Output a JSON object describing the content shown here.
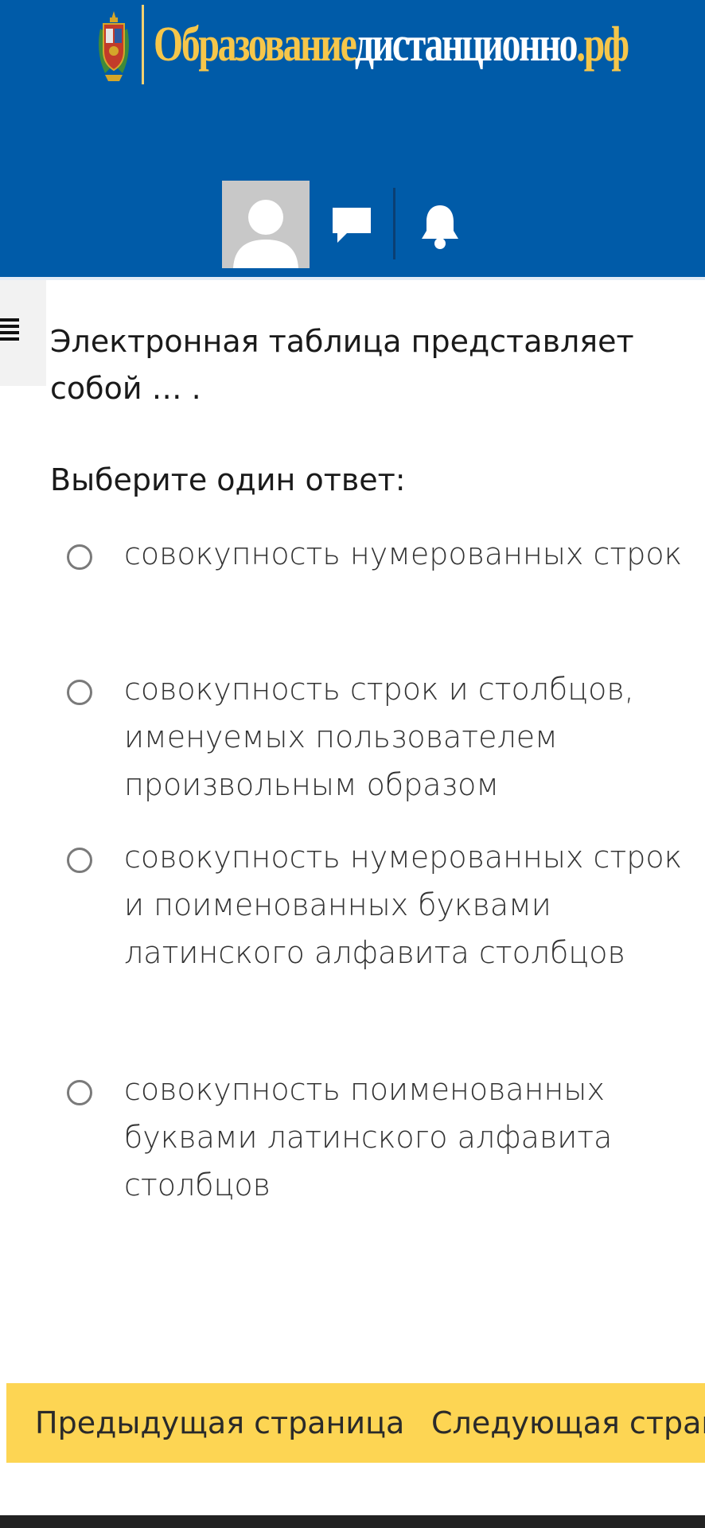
{
  "header": {
    "logo": {
      "part1": "Образование",
      "part2": "дистанционно",
      "part3": ".рф"
    },
    "background_color": "#005ba8",
    "icons": [
      "user-avatar",
      "messages-icon",
      "notifications-bell-icon"
    ]
  },
  "drawer": {
    "icon": "hamburger-menu-icon"
  },
  "question": {
    "text": "Электронная таблица представляет собой  … .",
    "prompt": "Выберите один ответ:",
    "options": [
      {
        "label": "совокупность нумерованных строк",
        "selected": false
      },
      {
        "label": "совокупность строк и столбцов, именуемых пользователем произвольным образом",
        "selected": false
      },
      {
        "label": "совокупность нумерованных строк и поименованных буквами латинского алфавита столбцов",
        "selected": false
      },
      {
        "label": "совокупность поименованных буквами латинского алфавита столбцов",
        "selected": false
      }
    ]
  },
  "navigation": {
    "prev_label": "Предыдущая страница",
    "next_label": "Следующая страница",
    "bar_color": "#fdd553"
  }
}
